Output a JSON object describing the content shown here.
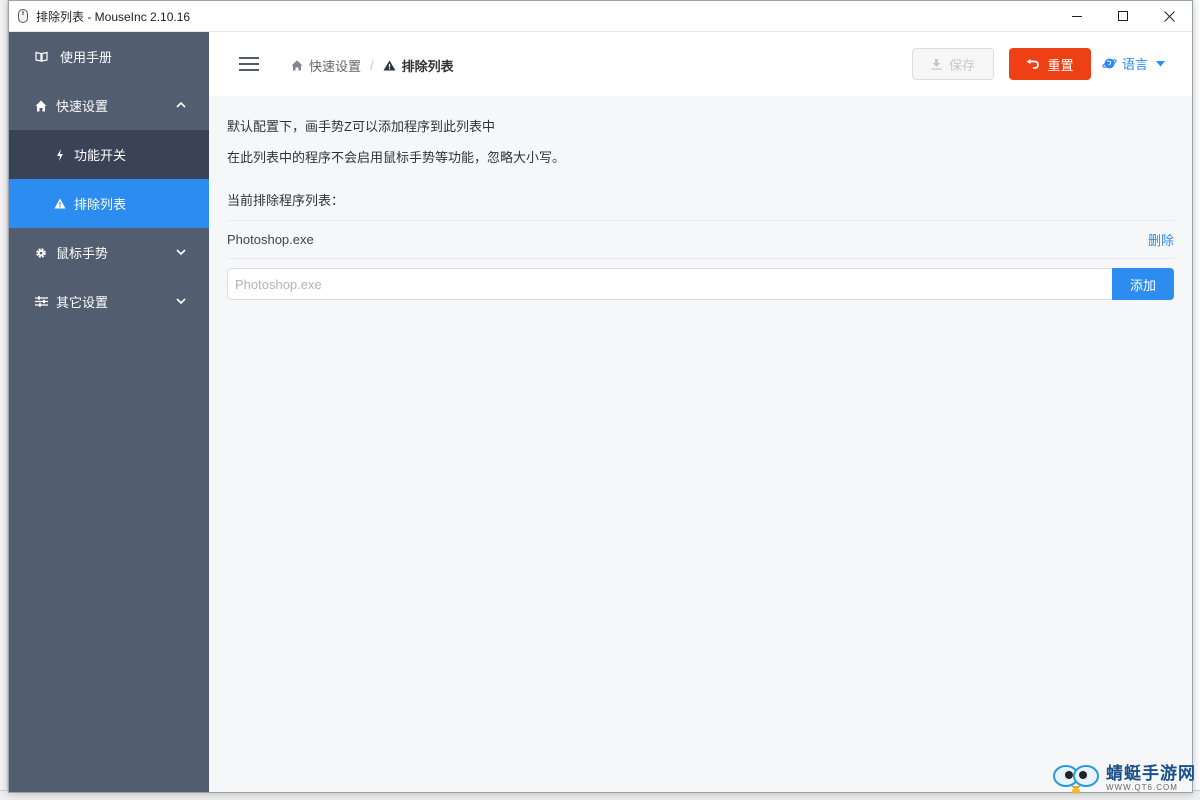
{
  "window": {
    "title": "排除列表 - MouseInc 2.10.16"
  },
  "sidebar": {
    "items": [
      {
        "label": "使用手册",
        "icon": "book-icon"
      },
      {
        "label": "快速设置",
        "icon": "home-icon",
        "expanded": true,
        "children": [
          {
            "label": "功能开关",
            "icon": "bolt-icon",
            "active": false
          },
          {
            "label": "排除列表",
            "icon": "warning-icon",
            "active": true
          }
        ]
      },
      {
        "label": "鼠标手势",
        "icon": "gear-icon",
        "expanded": false
      },
      {
        "label": "其它设置",
        "icon": "sliders-icon",
        "expanded": false
      }
    ]
  },
  "header": {
    "breadcrumb": [
      {
        "label": "快速设置",
        "icon": "home-icon"
      },
      {
        "label": "排除列表",
        "icon": "warning-icon"
      }
    ],
    "save_label": "保存",
    "reset_label": "重置",
    "language_label": "语言"
  },
  "main": {
    "desc_line1": "默认配置下，画手势Z可以添加程序到此列表中",
    "desc_line2": "在此列表中的程序不会启用鼠标手势等功能，忽略大小写。",
    "list_title": "当前排除程序列表：",
    "excluded": [
      {
        "name": "Photoshop.exe",
        "delete_label": "删除"
      }
    ],
    "add_input": {
      "placeholder": "Photoshop.exe",
      "value": ""
    },
    "add_label": "添加"
  },
  "watermark": {
    "main": "蜻蜓手游网",
    "sub": "WWW.QT6.COM"
  },
  "colors": {
    "sidebar_bg": "#535d70",
    "sidebar_sub_bg": "#3a4256",
    "active": "#2d8cf0",
    "danger": "#ed4014"
  }
}
